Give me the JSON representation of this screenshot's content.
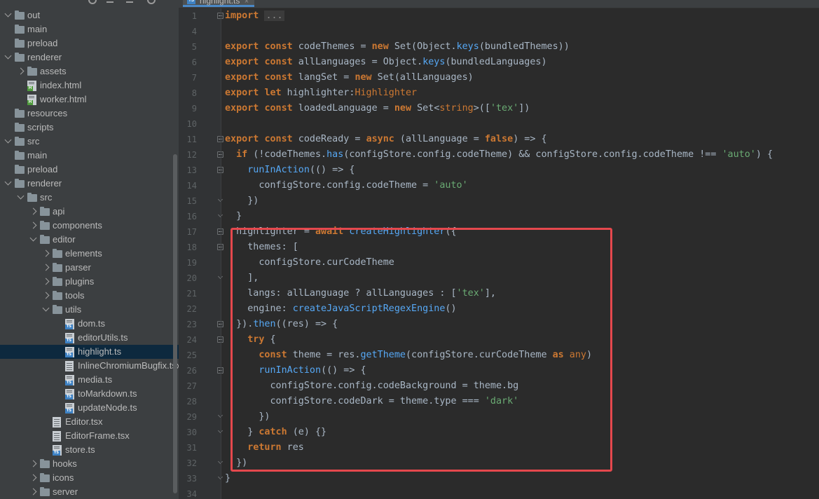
{
  "sidebar": {
    "items": [
      {
        "label": "out",
        "type": "folder",
        "depth": 0,
        "expanded": true
      },
      {
        "label": "main",
        "type": "folder",
        "depth": 0
      },
      {
        "label": "preload",
        "type": "folder",
        "depth": 0
      },
      {
        "label": "renderer",
        "type": "folder",
        "depth": 0,
        "expanded": true
      },
      {
        "label": "assets",
        "type": "folder",
        "depth": 1,
        "expanded": false
      },
      {
        "label": "index.html",
        "type": "html",
        "depth": 1
      },
      {
        "label": "worker.html",
        "type": "html",
        "depth": 1
      },
      {
        "label": "resources",
        "type": "folder",
        "depth": 0
      },
      {
        "label": "scripts",
        "type": "folder",
        "depth": 0
      },
      {
        "label": "src",
        "type": "folder",
        "depth": 0,
        "expanded": true
      },
      {
        "label": "main",
        "type": "folder",
        "depth": 0
      },
      {
        "label": "preload",
        "type": "folder",
        "depth": 0
      },
      {
        "label": "renderer",
        "type": "folder",
        "depth": 0,
        "expanded": true
      },
      {
        "label": "src",
        "type": "folder",
        "depth": 1,
        "expanded": true
      },
      {
        "label": "api",
        "type": "folder",
        "depth": 2,
        "expanded": false
      },
      {
        "label": "components",
        "type": "folder",
        "depth": 2,
        "expanded": false
      },
      {
        "label": "editor",
        "type": "folder",
        "depth": 2,
        "expanded": true
      },
      {
        "label": "elements",
        "type": "folder",
        "depth": 3,
        "expanded": false
      },
      {
        "label": "parser",
        "type": "folder",
        "depth": 3,
        "expanded": false
      },
      {
        "label": "plugins",
        "type": "folder",
        "depth": 3,
        "expanded": false
      },
      {
        "label": "tools",
        "type": "folder",
        "depth": 3,
        "expanded": false
      },
      {
        "label": "utils",
        "type": "folder",
        "depth": 3,
        "expanded": true
      },
      {
        "label": "dom.ts",
        "type": "ts",
        "depth": 4
      },
      {
        "label": "editorUtils.ts",
        "type": "ts",
        "depth": 4
      },
      {
        "label": "highlight.ts",
        "type": "ts",
        "depth": 4,
        "selected": true
      },
      {
        "label": "InlineChromiumBugfix.tsx",
        "type": "tsx",
        "depth": 4
      },
      {
        "label": "media.ts",
        "type": "ts",
        "depth": 4
      },
      {
        "label": "toMarkdown.ts",
        "type": "ts",
        "depth": 4
      },
      {
        "label": "updateNode.ts",
        "type": "ts",
        "depth": 4
      },
      {
        "label": "Editor.tsx",
        "type": "tsx",
        "depth": 3
      },
      {
        "label": "EditorFrame.tsx",
        "type": "tsx",
        "depth": 3
      },
      {
        "label": "store.ts",
        "type": "ts",
        "depth": 3
      },
      {
        "label": "hooks",
        "type": "folder",
        "depth": 2,
        "expanded": false
      },
      {
        "label": "icons",
        "type": "folder",
        "depth": 2,
        "expanded": false
      },
      {
        "label": "server",
        "type": "folder",
        "depth": 2,
        "expanded": false
      }
    ]
  },
  "editor": {
    "tab_label": "highlight.ts",
    "line_numbers": [
      "1",
      "4",
      "5",
      "6",
      "7",
      "8",
      "9",
      "10",
      "11",
      "12",
      "13",
      "14",
      "15",
      "16",
      "17",
      "18",
      "19",
      "20",
      "21",
      "22",
      "23",
      "24",
      "25",
      "26",
      "27",
      "28",
      "29",
      "30",
      "31",
      "32",
      "33",
      "34"
    ],
    "folded_placeholder": "...",
    "code_lines": [
      "import ...",
      "",
      "export const codeThemes = new Set(Object.keys(bundledThemes))",
      "export const allLanguages = Object.keys(bundledLanguages)",
      "export const langSet = new Set(allLanguages)",
      "export let highlighter:Highlighter",
      "export const loadedLanguage = new Set<string>(['tex'])",
      "",
      "export const codeReady = async (allLanguage = false) => {",
      "  if (!codeThemes.has(configStore.config.codeTheme) && configStore.config.codeTheme !== 'auto') {",
      "    runInAction(() => {",
      "      configStore.config.codeTheme = 'auto'",
      "    })",
      "  }",
      "  highlighter = await createHighlighter({",
      "    themes: [",
      "      configStore.curCodeTheme",
      "    ],",
      "    langs: allLanguage ? allLanguages : ['tex'],",
      "    engine: createJavaScriptRegexEngine()",
      "  }).then((res) => {",
      "    try {",
      "      const theme = res.getTheme(configStore.curCodeTheme as any)",
      "      runInAction(() => {",
      "        configStore.config.codeBackground = theme.bg",
      "        configStore.codeDark = theme.type === 'dark'",
      "      })",
      "    } catch (e) {}",
      "    return res",
      "  })",
      "}",
      ""
    ]
  },
  "colors": {
    "keyword": "#cc7832",
    "function": "#56a8f5",
    "string": "#6aab73",
    "highlight_box": "#e5484d",
    "selection": "#0d293e"
  }
}
